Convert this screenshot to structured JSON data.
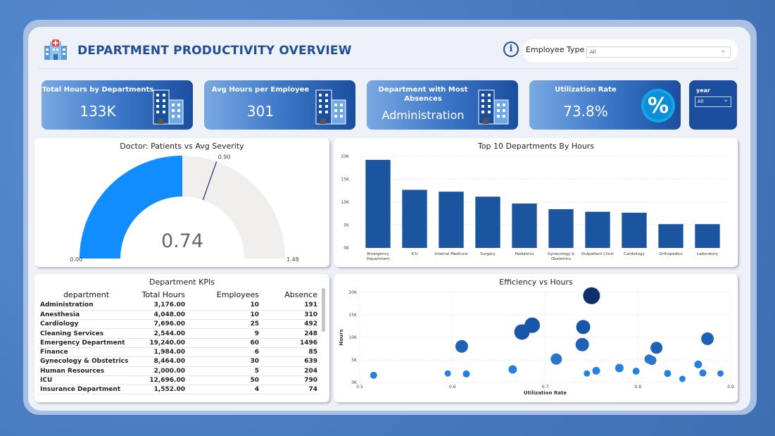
{
  "header": {
    "title": "DEPARTMENT PRODUCTIVITY OVERVIEW",
    "employee_type_label": "Employee Type",
    "employee_type_value": "All"
  },
  "kpis": [
    {
      "title": "Total Hours by Departments",
      "value": "133K",
      "icon": "building-icon"
    },
    {
      "title": "Avg Hours per Employee",
      "value": "301",
      "icon": "building-icon"
    },
    {
      "title": "Department with Most Absences",
      "value": "Administration",
      "icon": "building-icon"
    },
    {
      "title": "Utilization Rate",
      "value": "73.8%",
      "icon": "percent-icon"
    }
  ],
  "year_filter": {
    "label": "year",
    "value": "All"
  },
  "colors": {
    "primary": "#1f4e94",
    "bar": "#1b55a0",
    "gauge_fill": "#118dff",
    "gauge_bg": "#f0efee"
  },
  "gauge": {
    "title": "Doctor: Patients vs Avg Severity",
    "value": 0.74,
    "value_label": "0.74",
    "min": 0.0,
    "max": 1.48,
    "min_label": "0.00",
    "max_label": "1.48",
    "target": 0.9,
    "target_label": "0.90"
  },
  "table": {
    "title": "Department KPIs",
    "columns": [
      "department",
      "Total Hours",
      "Employees",
      "Absence"
    ],
    "rows": [
      [
        "Administration",
        "3,176.00",
        "10",
        "191"
      ],
      [
        "Anesthesia",
        "4,048.00",
        "10",
        "310"
      ],
      [
        "Cardiology",
        "7,696.00",
        "25",
        "492"
      ],
      [
        "Cleaning Services",
        "2,544.00",
        "9",
        "248"
      ],
      [
        "Emergency Department",
        "19,240.00",
        "60",
        "1496"
      ],
      [
        "Finance",
        "1,984.00",
        "6",
        "85"
      ],
      [
        "Gynecology & Obstetrics",
        "8,464.00",
        "30",
        "639"
      ],
      [
        "Human Resources",
        "2,000.00",
        "5",
        "204"
      ],
      [
        "ICU",
        "12,696.00",
        "50",
        "790"
      ],
      [
        "Insurance Department",
        "1,552.00",
        "4",
        "74"
      ]
    ]
  },
  "chart_data": [
    {
      "type": "bar",
      "title": "Top 10 Departments By Hours",
      "categories": [
        "Emergency Department",
        "ICU",
        "Internal Medicine",
        "Surgery",
        "Pediatrics",
        "Gynecology & Obstetrics",
        "Outpatient Clinic",
        "Cardiology",
        "Orthopedics",
        "Laboratory"
      ],
      "values": [
        19240,
        12696,
        12300,
        11200,
        9700,
        8464,
        7900,
        7696,
        5200,
        5200
      ],
      "ylim": [
        0,
        20000
      ],
      "yticks": [
        "0K",
        "5K",
        "10K",
        "15K",
        "20K"
      ],
      "grid": true
    },
    {
      "type": "scatter",
      "title": "Efficiency vs Hours",
      "xlabel": "Utilization Rate",
      "ylabel": "Hours",
      "xlim": [
        0.5,
        0.9
      ],
      "ylim": [
        0,
        20000
      ],
      "xticks": [
        "0.5",
        "0.6",
        "0.7",
        "0.8",
        "0.9"
      ],
      "yticks": [
        "0K",
        "5K",
        "10K",
        "15K",
        "20K"
      ],
      "points": [
        {
          "x": 0.515,
          "y": 1600,
          "s": 5,
          "c": "#2680e0"
        },
        {
          "x": 0.595,
          "y": 2000,
          "s": 4.5,
          "c": "#2680e0"
        },
        {
          "x": 0.61,
          "y": 8000,
          "s": 9,
          "c": "#1e62b6"
        },
        {
          "x": 0.615,
          "y": 1900,
          "s": 5,
          "c": "#2680e0"
        },
        {
          "x": 0.665,
          "y": 2900,
          "s": 6,
          "c": "#2680e0"
        },
        {
          "x": 0.675,
          "y": 11200,
          "s": 11,
          "c": "#1a56a8"
        },
        {
          "x": 0.686,
          "y": 12700,
          "s": 11,
          "c": "#1a56a8"
        },
        {
          "x": 0.712,
          "y": 5200,
          "s": 8,
          "c": "#2a74cc"
        },
        {
          "x": 0.74,
          "y": 8400,
          "s": 9.5,
          "c": "#1e62b6"
        },
        {
          "x": 0.741,
          "y": 12300,
          "s": 10,
          "c": "#1a56a8"
        },
        {
          "x": 0.745,
          "y": 2000,
          "s": 4.5,
          "c": "#2680e0"
        },
        {
          "x": 0.75,
          "y": 19240,
          "s": 12,
          "c": "#0e2f6e"
        },
        {
          "x": 0.755,
          "y": 2600,
          "s": 5.5,
          "c": "#2680e0"
        },
        {
          "x": 0.78,
          "y": 3200,
          "s": 6,
          "c": "#2680e0"
        },
        {
          "x": 0.798,
          "y": 2500,
          "s": 5,
          "c": "#2680e0"
        },
        {
          "x": 0.812,
          "y": 5200,
          "s": 6.5,
          "c": "#2a74cc"
        },
        {
          "x": 0.815,
          "y": 4900,
          "s": 6.5,
          "c": "#2a74cc"
        },
        {
          "x": 0.82,
          "y": 7700,
          "s": 8.5,
          "c": "#1e62b6"
        },
        {
          "x": 0.832,
          "y": 2000,
          "s": 5,
          "c": "#2680e0"
        },
        {
          "x": 0.848,
          "y": 800,
          "s": 4.5,
          "c": "#2680e0"
        },
        {
          "x": 0.865,
          "y": 4000,
          "s": 5.5,
          "c": "#2680e0"
        },
        {
          "x": 0.87,
          "y": 2100,
          "s": 5,
          "c": "#2680e0"
        },
        {
          "x": 0.875,
          "y": 9700,
          "s": 9,
          "c": "#1e62b6"
        },
        {
          "x": 0.889,
          "y": 2000,
          "s": 4.5,
          "c": "#2680e0"
        }
      ],
      "grid": true
    }
  ]
}
